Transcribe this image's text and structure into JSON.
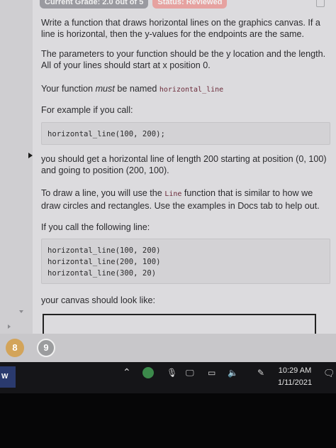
{
  "header": {
    "grade": "Current Grade: 2.0 out of 5",
    "status": "Status: Reviewed"
  },
  "instructions": {
    "p1": "Write a function that draws horizontal lines on the graphics canvas. If a line is horizontal, then the y-values for the endpoints are the same.",
    "p2": "The parameters to your function should be the y location and the length. All of your lines should start at x position 0.",
    "p3_pre": "Your function ",
    "p3_em": "must",
    "p3_mid": " be named ",
    "p3_code": "horizontal_line",
    "p4": "For example if you call:",
    "code1": "horizontal_line(100, 200);",
    "p5": "you should get a horizontal line of length 200 starting at position (0, 100) and going to position (200, 100).",
    "p6_pre": "To draw a line, you will use the ",
    "p6_code": "Line",
    "p6_post": " function that is similar to how we draw circles and rectangles. Use the examples in Docs tab to help out.",
    "p7": "If you call the following line:",
    "code2": "horizontal_line(100, 200)\nhorizontal_line(200, 100)\nhorizontal_line(300, 20)",
    "p8": "your canvas should look like:"
  },
  "pagination": {
    "page_8": "8",
    "page_9": "9"
  },
  "taskbar": {
    "app_label": "W",
    "chevron": "⌃",
    "mic": "🎙",
    "monitor": "🖵",
    "chat": "▭",
    "volume": "🔈",
    "pen": "✎",
    "time": "10:29 AM",
    "date": "1/11/2021",
    "notification": "🗨"
  }
}
